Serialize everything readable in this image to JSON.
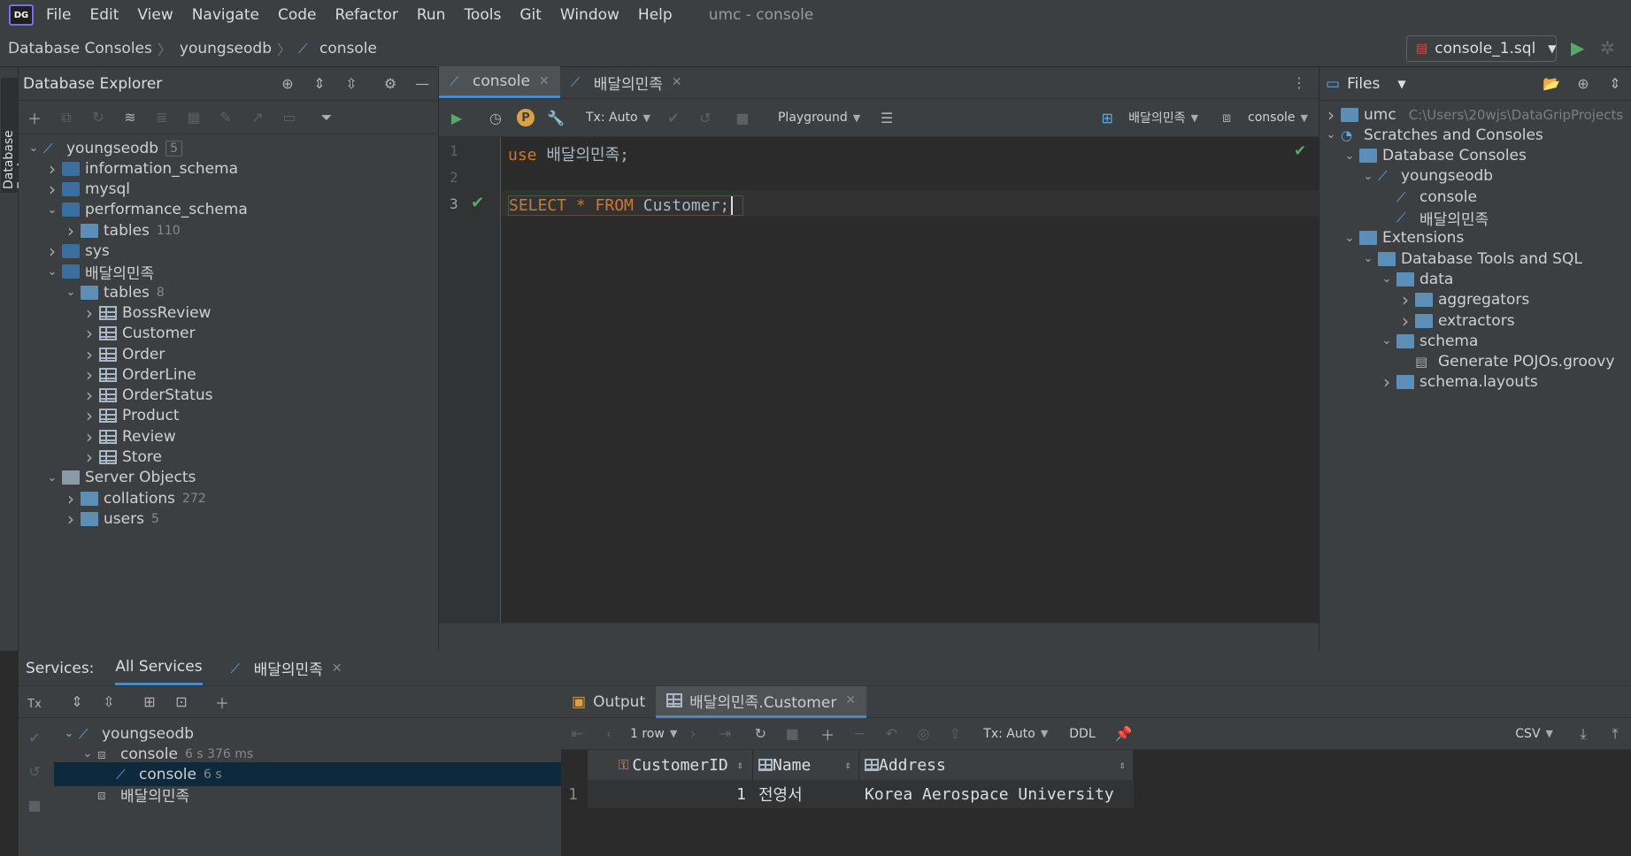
{
  "menubar": {
    "items": [
      "File",
      "Edit",
      "View",
      "Navigate",
      "Code",
      "Refactor",
      "Run",
      "Tools",
      "Git",
      "Window",
      "Help"
    ],
    "title": "umc - console"
  },
  "navbar": {
    "crumbs": [
      "Database Consoles",
      "youngseodb",
      "console"
    ],
    "run_config": "console_1.sql"
  },
  "left_stripe": {
    "label": "Database Explorer"
  },
  "db_explorer": {
    "title": "Database Explorer",
    "tree": [
      {
        "label": "youngseodb",
        "count": "5",
        "icon": "datasource-icon",
        "arrow": "down",
        "level": 0
      },
      {
        "label": "information_schema",
        "count": "",
        "icon": "schema-icon",
        "arrow": "right",
        "level": 1
      },
      {
        "label": "mysql",
        "count": "",
        "icon": "schema-icon",
        "arrow": "right",
        "level": 1
      },
      {
        "label": "performance_schema",
        "count": "",
        "icon": "schema-icon",
        "arrow": "down",
        "level": 1
      },
      {
        "label": "tables",
        "count": "110",
        "icon": "folder-icon",
        "arrow": "right",
        "level": 2
      },
      {
        "label": "sys",
        "count": "",
        "icon": "schema-icon",
        "arrow": "right",
        "level": 1
      },
      {
        "label": "배달의민족",
        "count": "",
        "icon": "schema-icon",
        "arrow": "down",
        "level": 1
      },
      {
        "label": "tables",
        "count": "8",
        "icon": "folder-icon",
        "arrow": "down",
        "level": 2
      },
      {
        "label": "BossReview",
        "count": "",
        "icon": "table-icon",
        "arrow": "right",
        "level": 3
      },
      {
        "label": "Customer",
        "count": "",
        "icon": "table-icon",
        "arrow": "right",
        "level": 3
      },
      {
        "label": "Order",
        "count": "",
        "icon": "table-icon",
        "arrow": "right",
        "level": 3
      },
      {
        "label": "OrderLine",
        "count": "",
        "icon": "table-icon",
        "arrow": "right",
        "level": 3
      },
      {
        "label": "OrderStatus",
        "count": "",
        "icon": "table-icon",
        "arrow": "right",
        "level": 3
      },
      {
        "label": "Product",
        "count": "",
        "icon": "table-icon",
        "arrow": "right",
        "level": 3
      },
      {
        "label": "Review",
        "count": "",
        "icon": "table-icon",
        "arrow": "right",
        "level": 3
      },
      {
        "label": "Store",
        "count": "",
        "icon": "table-icon",
        "arrow": "right",
        "level": 3
      },
      {
        "label": "Server Objects",
        "count": "",
        "icon": "server-objects-icon",
        "arrow": "down",
        "level": 1
      },
      {
        "label": "collations",
        "count": "272",
        "icon": "folder-icon",
        "arrow": "right",
        "level": 2
      },
      {
        "label": "users",
        "count": "5",
        "icon": "folder-icon",
        "arrow": "right",
        "level": 2
      }
    ]
  },
  "editor": {
    "tabs": [
      {
        "label": "console"
      },
      {
        "label": "배달의민족"
      }
    ],
    "toolbar": {
      "tx": "Tx: Auto",
      "playground": "Playground",
      "schema": "배달의민족",
      "session": "console"
    },
    "lines": [
      {
        "no": "1",
        "kw": "use",
        "rest": " 배달의민족;"
      },
      {
        "no": "2",
        "kw": "",
        "rest": ""
      },
      {
        "no": "3",
        "kw": "SELECT * FROM",
        "rest": " Customer;"
      }
    ]
  },
  "files": {
    "title": "Files",
    "tree": [
      {
        "label": "umc",
        "path": "C:\\Users\\20wjs\\DataGripProjects",
        "icon": "folder-icon",
        "arrow": "right",
        "level": 0
      },
      {
        "label": "Scratches and Consoles",
        "path": "",
        "icon": "scratches-icon",
        "arrow": "down",
        "level": 0
      },
      {
        "label": "Database Consoles",
        "path": "",
        "icon": "folder-icon",
        "arrow": "down",
        "level": 1
      },
      {
        "label": "youngseodb",
        "path": "",
        "icon": "datasource-icon",
        "arrow": "down",
        "level": 2
      },
      {
        "label": "console",
        "path": "",
        "icon": "console-icon",
        "arrow": "",
        "level": 3
      },
      {
        "label": "배달의민족",
        "path": "",
        "icon": "console-icon",
        "arrow": "",
        "level": 3
      },
      {
        "label": "Extensions",
        "path": "",
        "icon": "folder-icon",
        "arrow": "down",
        "level": 1
      },
      {
        "label": "Database Tools and SQL",
        "path": "",
        "icon": "folder-icon",
        "arrow": "down",
        "level": 2
      },
      {
        "label": "data",
        "path": "",
        "icon": "folder-icon",
        "arrow": "down",
        "level": 3
      },
      {
        "label": "aggregators",
        "path": "",
        "icon": "folder-icon",
        "arrow": "right",
        "level": 4
      },
      {
        "label": "extractors",
        "path": "",
        "icon": "folder-icon",
        "arrow": "right",
        "level": 4
      },
      {
        "label": "schema",
        "path": "",
        "icon": "folder-icon",
        "arrow": "down",
        "level": 3
      },
      {
        "label": "Generate POJOs.groovy",
        "path": "",
        "icon": "file-icon",
        "arrow": "",
        "level": 4
      },
      {
        "label": "schema.layouts",
        "path": "",
        "icon": "folder-icon",
        "arrow": "right",
        "level": 3
      }
    ]
  },
  "services": {
    "label": "Services:",
    "tabs": [
      {
        "label": "All Services"
      },
      {
        "label": "배달의민족"
      }
    ],
    "tree": [
      {
        "label": "youngseodb",
        "meta": "",
        "arrow": "down",
        "level": 0,
        "icon": "datasource-icon"
      },
      {
        "label": "console",
        "meta": "6 s 376 ms",
        "arrow": "down",
        "level": 1,
        "icon": "session-icon"
      },
      {
        "label": "console",
        "meta": "6 s",
        "arrow": "",
        "level": 2,
        "icon": "datasource-icon"
      },
      {
        "label": "배달의민족",
        "meta": "",
        "arrow": "",
        "level": 1,
        "icon": "session-icon"
      }
    ],
    "result_tabs": [
      {
        "label": "Output"
      },
      {
        "label": "배달의민족.Customer"
      }
    ],
    "result_toolbar": {
      "rows": "1 row",
      "tx": "Tx: Auto",
      "ddl": "DDL",
      "export": "CSV"
    },
    "grid": {
      "columns": [
        "CustomerID",
        "Name",
        "Address"
      ],
      "rows": [
        {
          "no": "1",
          "cells": [
            "1",
            "전영서",
            "Korea Aerospace University"
          ]
        }
      ]
    }
  }
}
